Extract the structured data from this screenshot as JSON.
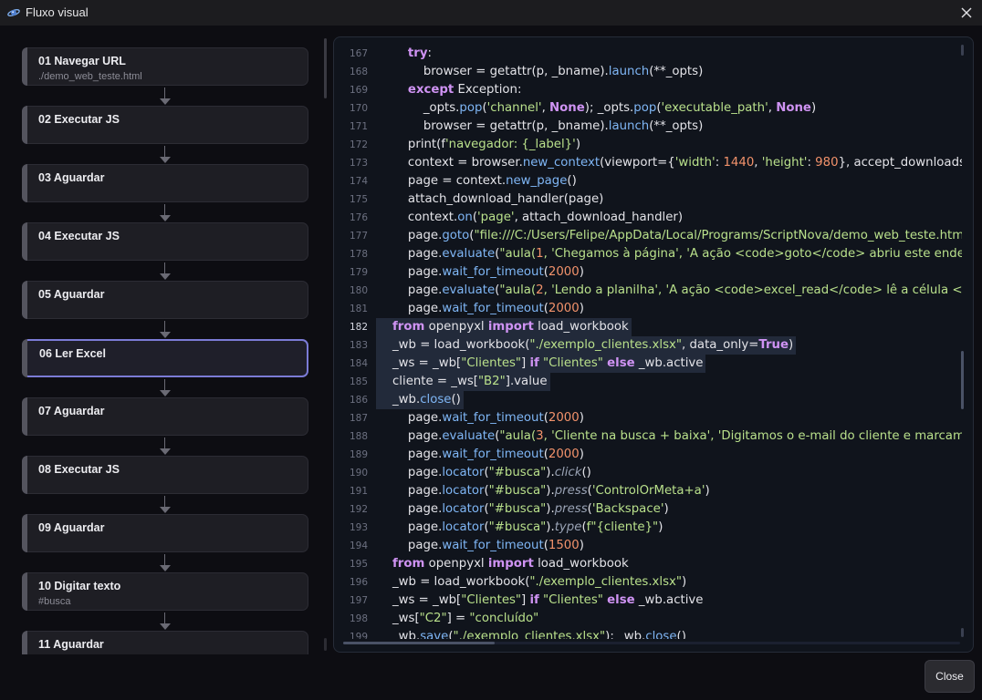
{
  "window": {
    "title": "Fluxo visual"
  },
  "steps": [
    {
      "label": "01  Navegar URL",
      "sub": "./demo_web_teste.html"
    },
    {
      "label": "02  Executar JS",
      "sub": ""
    },
    {
      "label": "03  Aguardar",
      "sub": ""
    },
    {
      "label": "04  Executar JS",
      "sub": ""
    },
    {
      "label": "05  Aguardar",
      "sub": ""
    },
    {
      "label": "06  Ler Excel",
      "sub": "",
      "active": true
    },
    {
      "label": "07  Aguardar",
      "sub": ""
    },
    {
      "label": "08  Executar JS",
      "sub": ""
    },
    {
      "label": "09  Aguardar",
      "sub": ""
    },
    {
      "label": "10  Digitar texto",
      "sub": "#busca"
    },
    {
      "label": "11  Aguardar",
      "sub": ""
    }
  ],
  "code": {
    "current_line": 182,
    "highlight_from": 182,
    "highlight_to": 186,
    "lines": [
      {
        "n": 167,
        "tokens": [
          [
            "    ",
            ""
          ],
          [
            "try",
            "kw"
          ],
          [
            ":",
            ""
          ]
        ]
      },
      {
        "n": 168,
        "tokens": [
          [
            "        browser = getattr(p, _bname).",
            ""
          ],
          [
            "launch",
            "fn"
          ],
          [
            "(**_opts)",
            ""
          ]
        ]
      },
      {
        "n": 169,
        "tokens": [
          [
            "    ",
            ""
          ],
          [
            "except",
            "kw"
          ],
          [
            " Exception:",
            ""
          ]
        ]
      },
      {
        "n": 170,
        "tokens": [
          [
            "        _opts.",
            ""
          ],
          [
            "pop",
            "fn"
          ],
          [
            "(",
            ""
          ],
          [
            "'channel'",
            "str"
          ],
          [
            ", ",
            ""
          ],
          [
            "None",
            "kw"
          ],
          [
            "); _opts.",
            ""
          ],
          [
            "pop",
            "fn"
          ],
          [
            "(",
            ""
          ],
          [
            "'executable_path'",
            "str"
          ],
          [
            ", ",
            ""
          ],
          [
            "None",
            "kw"
          ],
          [
            ")",
            ""
          ]
        ]
      },
      {
        "n": 171,
        "tokens": [
          [
            "        browser = getattr(p, _bname).",
            ""
          ],
          [
            "launch",
            "fn"
          ],
          [
            "(**_opts)",
            ""
          ]
        ]
      },
      {
        "n": 172,
        "tokens": [
          [
            "    print(f",
            ""
          ],
          [
            "'navegador: {_label}'",
            "str"
          ],
          [
            ")",
            ""
          ]
        ]
      },
      {
        "n": 173,
        "tokens": [
          [
            "    context = browser.",
            ""
          ],
          [
            "new_context",
            "fn"
          ],
          [
            "(viewport={",
            ""
          ],
          [
            "'width'",
            "str"
          ],
          [
            ": ",
            ""
          ],
          [
            "1440",
            "num"
          ],
          [
            ", ",
            ""
          ],
          [
            "'height'",
            "str"
          ],
          [
            ": ",
            ""
          ],
          [
            "980",
            "num"
          ],
          [
            "}, accept_downloads=",
            ""
          ],
          [
            "True",
            "kw"
          ]
        ]
      },
      {
        "n": 174,
        "tokens": [
          [
            "    page = context.",
            ""
          ],
          [
            "new_page",
            "fn"
          ],
          [
            "()",
            ""
          ]
        ]
      },
      {
        "n": 175,
        "tokens": [
          [
            "    attach_download_handler(page)",
            ""
          ]
        ]
      },
      {
        "n": 176,
        "tokens": [
          [
            "    context.",
            ""
          ],
          [
            "on",
            "fn"
          ],
          [
            "(",
            ""
          ],
          [
            "'page'",
            "str"
          ],
          [
            ", attach_download_handler)",
            ""
          ]
        ]
      },
      {
        "n": 177,
        "tokens": [
          [
            "    page.",
            ""
          ],
          [
            "goto",
            "fn"
          ],
          [
            "(",
            ""
          ],
          [
            "\"file:///C:/Users/Felipe/AppData/Local/Programs/ScriptNova/demo_web_teste.htm",
            "str"
          ]
        ]
      },
      {
        "n": 178,
        "tokens": [
          [
            "    page.",
            ""
          ],
          [
            "evaluate",
            "fn"
          ],
          [
            "(",
            ""
          ],
          [
            "\"aula(",
            "str"
          ],
          [
            "1",
            "num"
          ],
          [
            ", 'Chegamos à página', 'A ação <code>goto</code> abriu este endereç",
            "str"
          ]
        ]
      },
      {
        "n": 179,
        "tokens": [
          [
            "    page.",
            ""
          ],
          [
            "wait_for_timeout",
            "fn"
          ],
          [
            "(",
            ""
          ],
          [
            "2000",
            "num"
          ],
          [
            ")",
            ""
          ]
        ]
      },
      {
        "n": 180,
        "tokens": [
          [
            "    page.",
            ""
          ],
          [
            "evaluate",
            "fn"
          ],
          [
            "(",
            ""
          ],
          [
            "\"aula(",
            "str"
          ],
          [
            "2",
            "num"
          ],
          [
            ", 'Lendo a planilha', 'A ação <code>excel_read</code> lê a célula <b>B",
            "str"
          ]
        ]
      },
      {
        "n": 181,
        "tokens": [
          [
            "    page.",
            ""
          ],
          [
            "wait_for_timeout",
            "fn"
          ],
          [
            "(",
            ""
          ],
          [
            "2000",
            "num"
          ],
          [
            ")",
            ""
          ]
        ]
      },
      {
        "n": 182,
        "tokens": [
          [
            "from",
            "kw"
          ],
          [
            " openpyxl ",
            ""
          ],
          [
            "import",
            "kw"
          ],
          [
            " load_workbook",
            ""
          ]
        ]
      },
      {
        "n": 183,
        "tokens": [
          [
            "_wb = load_workbook(",
            ""
          ],
          [
            "\"./exemplo_clientes.xlsx\"",
            "str"
          ],
          [
            ", data_only=",
            ""
          ],
          [
            "True",
            "kw"
          ],
          [
            ")",
            ""
          ]
        ]
      },
      {
        "n": 184,
        "tokens": [
          [
            "_ws = _wb[",
            ""
          ],
          [
            "\"Clientes\"",
            "str"
          ],
          [
            "] ",
            ""
          ],
          [
            "if",
            "kw"
          ],
          [
            " ",
            ""
          ],
          [
            "\"Clientes\"",
            "str"
          ],
          [
            " ",
            ""
          ],
          [
            "else",
            "kw"
          ],
          [
            " _wb.active",
            ""
          ]
        ]
      },
      {
        "n": 185,
        "tokens": [
          [
            "cliente = _ws[",
            ""
          ],
          [
            "\"B2\"",
            "str"
          ],
          [
            "].value",
            ""
          ]
        ]
      },
      {
        "n": 186,
        "tokens": [
          [
            "_wb.",
            ""
          ],
          [
            "close",
            "fn"
          ],
          [
            "()",
            ""
          ]
        ]
      },
      {
        "n": 187,
        "tokens": [
          [
            "    page.",
            ""
          ],
          [
            "wait_for_timeout",
            "fn"
          ],
          [
            "(",
            ""
          ],
          [
            "2000",
            "num"
          ],
          [
            ")",
            ""
          ]
        ]
      },
      {
        "n": 188,
        "tokens": [
          [
            "    page.",
            ""
          ],
          [
            "evaluate",
            "fn"
          ],
          [
            "(",
            ""
          ],
          [
            "\"aula(",
            "str"
          ],
          [
            "3",
            "num"
          ],
          [
            ", 'Cliente na busca + baixa', 'Digitamos o e-mail do cliente e marcamos -",
            "str"
          ]
        ]
      },
      {
        "n": 189,
        "tokens": [
          [
            "    page.",
            ""
          ],
          [
            "wait_for_timeout",
            "fn"
          ],
          [
            "(",
            ""
          ],
          [
            "2000",
            "num"
          ],
          [
            ")",
            ""
          ]
        ]
      },
      {
        "n": 190,
        "tokens": [
          [
            "    page.",
            ""
          ],
          [
            "locator",
            "fn"
          ],
          [
            "(",
            ""
          ],
          [
            "\"#busca\"",
            "str"
          ],
          [
            ").",
            ""
          ],
          [
            "click",
            "it"
          ],
          [
            "()",
            ""
          ]
        ]
      },
      {
        "n": 191,
        "tokens": [
          [
            "    page.",
            ""
          ],
          [
            "locator",
            "fn"
          ],
          [
            "(",
            ""
          ],
          [
            "\"#busca\"",
            "str"
          ],
          [
            ").",
            ""
          ],
          [
            "press",
            "it"
          ],
          [
            "(",
            ""
          ],
          [
            "'ControlOrMeta+a'",
            "str"
          ],
          [
            ")",
            ""
          ]
        ]
      },
      {
        "n": 192,
        "tokens": [
          [
            "    page.",
            ""
          ],
          [
            "locator",
            "fn"
          ],
          [
            "(",
            ""
          ],
          [
            "\"#busca\"",
            "str"
          ],
          [
            ").",
            ""
          ],
          [
            "press",
            "it"
          ],
          [
            "(",
            ""
          ],
          [
            "'Backspace'",
            "str"
          ],
          [
            ")",
            ""
          ]
        ]
      },
      {
        "n": 193,
        "tokens": [
          [
            "    page.",
            ""
          ],
          [
            "locator",
            "fn"
          ],
          [
            "(",
            ""
          ],
          [
            "\"#busca\"",
            "str"
          ],
          [
            ").",
            ""
          ],
          [
            "type",
            "it"
          ],
          [
            "(",
            ""
          ],
          [
            "f\"{cliente}\"",
            "str"
          ],
          [
            ")",
            ""
          ]
        ]
      },
      {
        "n": 194,
        "tokens": [
          [
            "    page.",
            ""
          ],
          [
            "wait_for_timeout",
            "fn"
          ],
          [
            "(",
            ""
          ],
          [
            "1500",
            "num"
          ],
          [
            ")",
            ""
          ]
        ]
      },
      {
        "n": 195,
        "tokens": [
          [
            "from",
            "kw"
          ],
          [
            " openpyxl ",
            ""
          ],
          [
            "import",
            "kw"
          ],
          [
            " load_workbook",
            ""
          ]
        ]
      },
      {
        "n": 196,
        "tokens": [
          [
            "_wb = load_workbook(",
            ""
          ],
          [
            "\"./exemplo_clientes.xlsx\"",
            "str"
          ],
          [
            ")",
            ""
          ]
        ]
      },
      {
        "n": 197,
        "tokens": [
          [
            "_ws = _wb[",
            ""
          ],
          [
            "\"Clientes\"",
            "str"
          ],
          [
            "] ",
            ""
          ],
          [
            "if",
            "kw"
          ],
          [
            " ",
            ""
          ],
          [
            "\"Clientes\"",
            "str"
          ],
          [
            " ",
            ""
          ],
          [
            "else",
            "kw"
          ],
          [
            " _wb.active",
            ""
          ]
        ]
      },
      {
        "n": 198,
        "tokens": [
          [
            "_ws[",
            ""
          ],
          [
            "\"C2\"",
            "str"
          ],
          [
            "] = ",
            ""
          ],
          [
            "\"concluído\"",
            "str"
          ]
        ]
      },
      {
        "n": 199,
        "tokens": [
          [
            "_wb.",
            ""
          ],
          [
            "save",
            "fn"
          ],
          [
            "(",
            ""
          ],
          [
            "\"./exemplo_clientes.xlsx\"",
            "str"
          ],
          [
            "); _wb.",
            ""
          ],
          [
            "close",
            "fn"
          ],
          [
            "()",
            ""
          ]
        ]
      }
    ]
  },
  "footer": {
    "close_label": "Close"
  }
}
